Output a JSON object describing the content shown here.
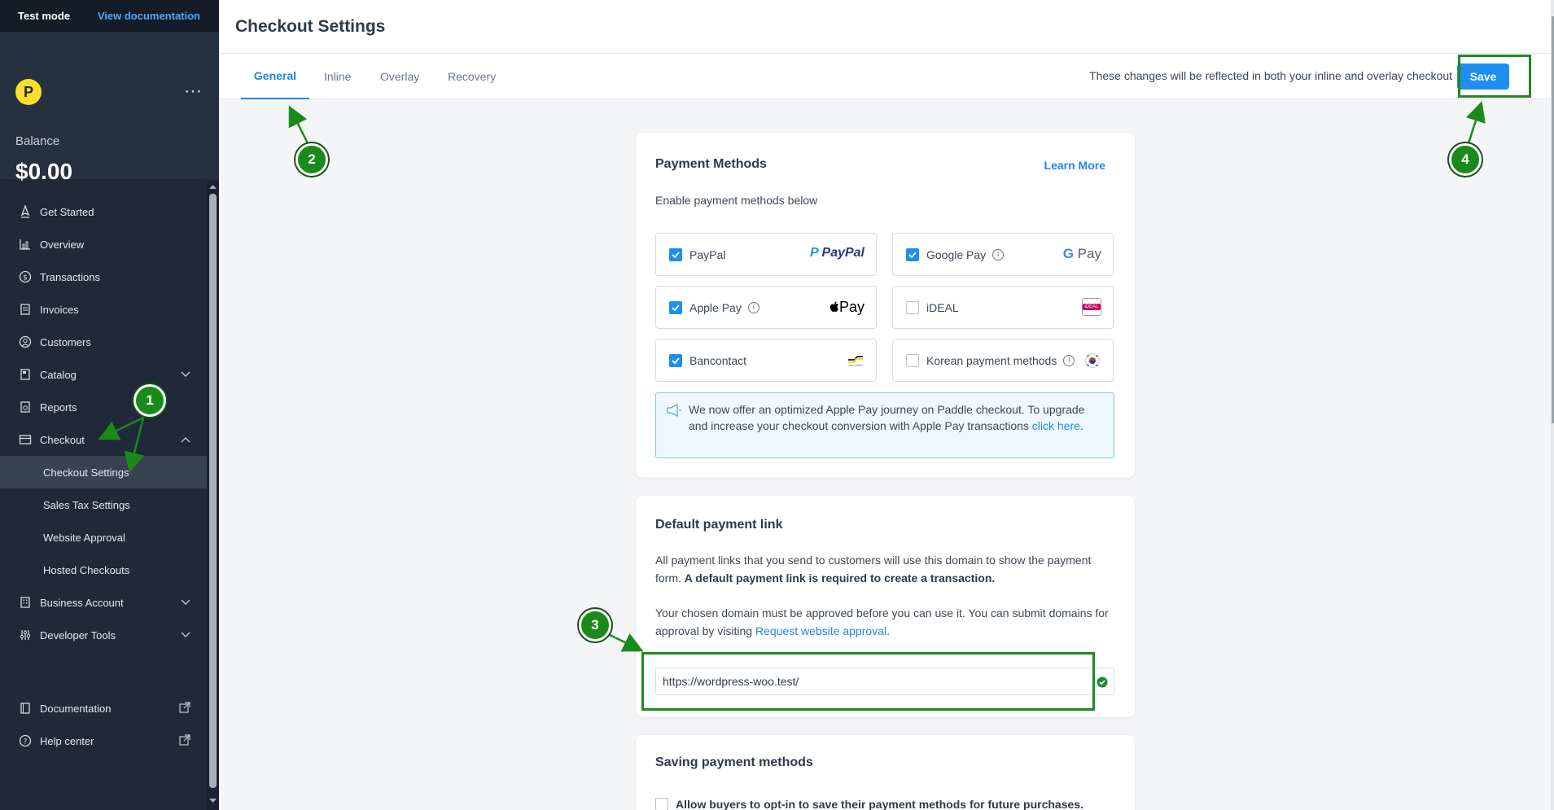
{
  "topbar": {
    "mode": "Test mode",
    "doc_link": "View documentation"
  },
  "brand": {
    "logo_letter": "P",
    "balance_label": "Balance",
    "balance_value": "$0.00"
  },
  "nav": {
    "get_started": "Get Started",
    "overview": "Overview",
    "transactions": "Transactions",
    "invoices": "Invoices",
    "customers": "Customers",
    "catalog": "Catalog",
    "reports": "Reports",
    "checkout": "Checkout",
    "checkout_sub": [
      "Checkout Settings",
      "Sales Tax Settings",
      "Website Approval",
      "Hosted Checkouts"
    ],
    "business_account": "Business Account",
    "developer_tools": "Developer Tools",
    "documentation": "Documentation",
    "help_center": "Help center"
  },
  "page": {
    "title": "Checkout Settings"
  },
  "tabs": [
    "General",
    "Inline",
    "Overlay",
    "Recovery"
  ],
  "tab_note": "These changes will be reflected in both your inline and overlay checkout",
  "save_label": "Save",
  "payment_methods": {
    "title": "Payment Methods",
    "learn_more": "Learn More",
    "subtitle": "Enable payment methods below",
    "items": [
      {
        "label": "PayPal",
        "checked": true,
        "logo": "PayPal"
      },
      {
        "label": "Google Pay",
        "checked": true,
        "logo": "Pay"
      },
      {
        "label": "Apple Pay",
        "checked": true,
        "logo": "Pay"
      },
      {
        "label": "iDEAL",
        "checked": false,
        "logo": "iDEAL"
      },
      {
        "label": "Bancontact",
        "checked": true,
        "logo": "bancontact"
      },
      {
        "label": "Korean payment methods",
        "checked": false,
        "logo": "korea-flag"
      }
    ],
    "notice_text": "We now offer an optimized Apple Pay journey on Paddle checkout. To upgrade and increase your checkout conversion with Apple Pay transactions ",
    "notice_link": "click here",
    "notice_end": "."
  },
  "default_link": {
    "title": "Default payment link",
    "para1": "All payment links that you send to customers will use this domain to show the payment form. ",
    "para1_bold": "A default payment link is required to create a transaction.",
    "para2": "Your chosen domain must be approved before you can use it. You can submit domains for approval by visiting ",
    "para2_link": "Request website approval",
    "para2_end": ".",
    "url_value": "https://wordpress-woo.test/"
  },
  "saving_methods": {
    "title": "Saving payment methods",
    "optin_label": "Allow buyers to opt-in to save their payment methods for future purchases."
  },
  "annotations": [
    "1",
    "2",
    "3",
    "4"
  ],
  "colors": {
    "accent": "#1f8ef1",
    "annotation": "#1a8a1a",
    "sidebar": "#202937"
  }
}
